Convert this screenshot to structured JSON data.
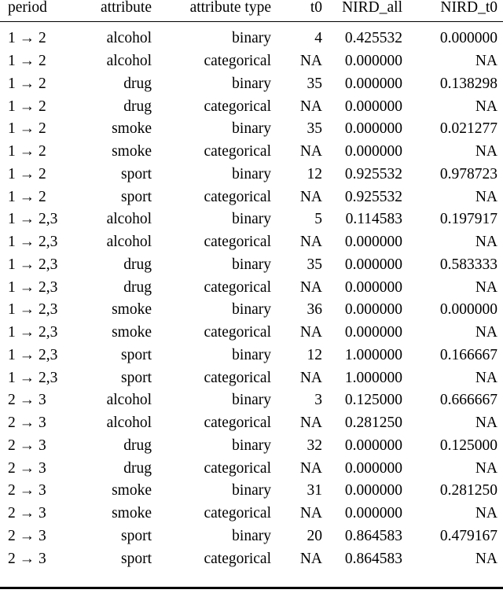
{
  "table": {
    "columns": [
      {
        "key": "period",
        "label": "period",
        "align": "left"
      },
      {
        "key": "attribute",
        "label": "attribute",
        "align": "right"
      },
      {
        "key": "attribute_type",
        "label": "attribute type",
        "align": "right"
      },
      {
        "key": "t0",
        "label": "t0",
        "align": "right"
      },
      {
        "key": "nird_all",
        "label": "NIRD_all",
        "align": "right"
      },
      {
        "key": "nird_t0",
        "label": "NIRD_t0",
        "align": "right"
      }
    ],
    "arrow_glyph": "→",
    "rows": [
      {
        "period": "1 → 2",
        "attribute": "alcohol",
        "attribute_type": "binary",
        "t0": "4",
        "nird_all": "0.425532",
        "nird_t0": "0.000000"
      },
      {
        "period": "1 → 2",
        "attribute": "alcohol",
        "attribute_type": "categorical",
        "t0": "NA",
        "nird_all": "0.000000",
        "nird_t0": "NA"
      },
      {
        "period": "1 → 2",
        "attribute": "drug",
        "attribute_type": "binary",
        "t0": "35",
        "nird_all": "0.000000",
        "nird_t0": "0.138298"
      },
      {
        "period": "1 → 2",
        "attribute": "drug",
        "attribute_type": "categorical",
        "t0": "NA",
        "nird_all": "0.000000",
        "nird_t0": "NA"
      },
      {
        "period": "1 → 2",
        "attribute": "smoke",
        "attribute_type": "binary",
        "t0": "35",
        "nird_all": "0.000000",
        "nird_t0": "0.021277"
      },
      {
        "period": "1 → 2",
        "attribute": "smoke",
        "attribute_type": "categorical",
        "t0": "NA",
        "nird_all": "0.000000",
        "nird_t0": "NA"
      },
      {
        "period": "1 → 2",
        "attribute": "sport",
        "attribute_type": "binary",
        "t0": "12",
        "nird_all": "0.925532",
        "nird_t0": "0.978723"
      },
      {
        "period": "1 → 2",
        "attribute": "sport",
        "attribute_type": "categorical",
        "t0": "NA",
        "nird_all": "0.925532",
        "nird_t0": "NA"
      },
      {
        "period": "1 → 2,3",
        "attribute": "alcohol",
        "attribute_type": "binary",
        "t0": "5",
        "nird_all": "0.114583",
        "nird_t0": "0.197917"
      },
      {
        "period": "1 → 2,3",
        "attribute": "alcohol",
        "attribute_type": "categorical",
        "t0": "NA",
        "nird_all": "0.000000",
        "nird_t0": "NA"
      },
      {
        "period": "1 → 2,3",
        "attribute": "drug",
        "attribute_type": "binary",
        "t0": "35",
        "nird_all": "0.000000",
        "nird_t0": "0.583333"
      },
      {
        "period": "1 → 2,3",
        "attribute": "drug",
        "attribute_type": "categorical",
        "t0": "NA",
        "nird_all": "0.000000",
        "nird_t0": "NA"
      },
      {
        "period": "1 → 2,3",
        "attribute": "smoke",
        "attribute_type": "binary",
        "t0": "36",
        "nird_all": "0.000000",
        "nird_t0": "0.000000"
      },
      {
        "period": "1 → 2,3",
        "attribute": "smoke",
        "attribute_type": "categorical",
        "t0": "NA",
        "nird_all": "0.000000",
        "nird_t0": "NA"
      },
      {
        "period": "1 → 2,3",
        "attribute": "sport",
        "attribute_type": "binary",
        "t0": "12",
        "nird_all": "1.000000",
        "nird_t0": "0.166667"
      },
      {
        "period": "1 → 2,3",
        "attribute": "sport",
        "attribute_type": "categorical",
        "t0": "NA",
        "nird_all": "1.000000",
        "nird_t0": "NA"
      },
      {
        "period": "2 → 3",
        "attribute": "alcohol",
        "attribute_type": "binary",
        "t0": "3",
        "nird_all": "0.125000",
        "nird_t0": "0.666667"
      },
      {
        "period": "2 → 3",
        "attribute": "alcohol",
        "attribute_type": "categorical",
        "t0": "NA",
        "nird_all": "0.281250",
        "nird_t0": "NA"
      },
      {
        "period": "2 → 3",
        "attribute": "drug",
        "attribute_type": "binary",
        "t0": "32",
        "nird_all": "0.000000",
        "nird_t0": "0.125000"
      },
      {
        "period": "2 → 3",
        "attribute": "drug",
        "attribute_type": "categorical",
        "t0": "NA",
        "nird_all": "0.000000",
        "nird_t0": "NA"
      },
      {
        "period": "2 → 3",
        "attribute": "smoke",
        "attribute_type": "binary",
        "t0": "31",
        "nird_all": "0.000000",
        "nird_t0": "0.281250"
      },
      {
        "period": "2 → 3",
        "attribute": "smoke",
        "attribute_type": "categorical",
        "t0": "NA",
        "nird_all": "0.000000",
        "nird_t0": "NA"
      },
      {
        "period": "2 → 3",
        "attribute": "sport",
        "attribute_type": "binary",
        "t0": "20",
        "nird_all": "0.864583",
        "nird_t0": "0.479167"
      },
      {
        "period": "2 → 3",
        "attribute": "sport",
        "attribute_type": "categorical",
        "t0": "NA",
        "nird_all": "0.864583",
        "nird_t0": "NA"
      }
    ]
  }
}
